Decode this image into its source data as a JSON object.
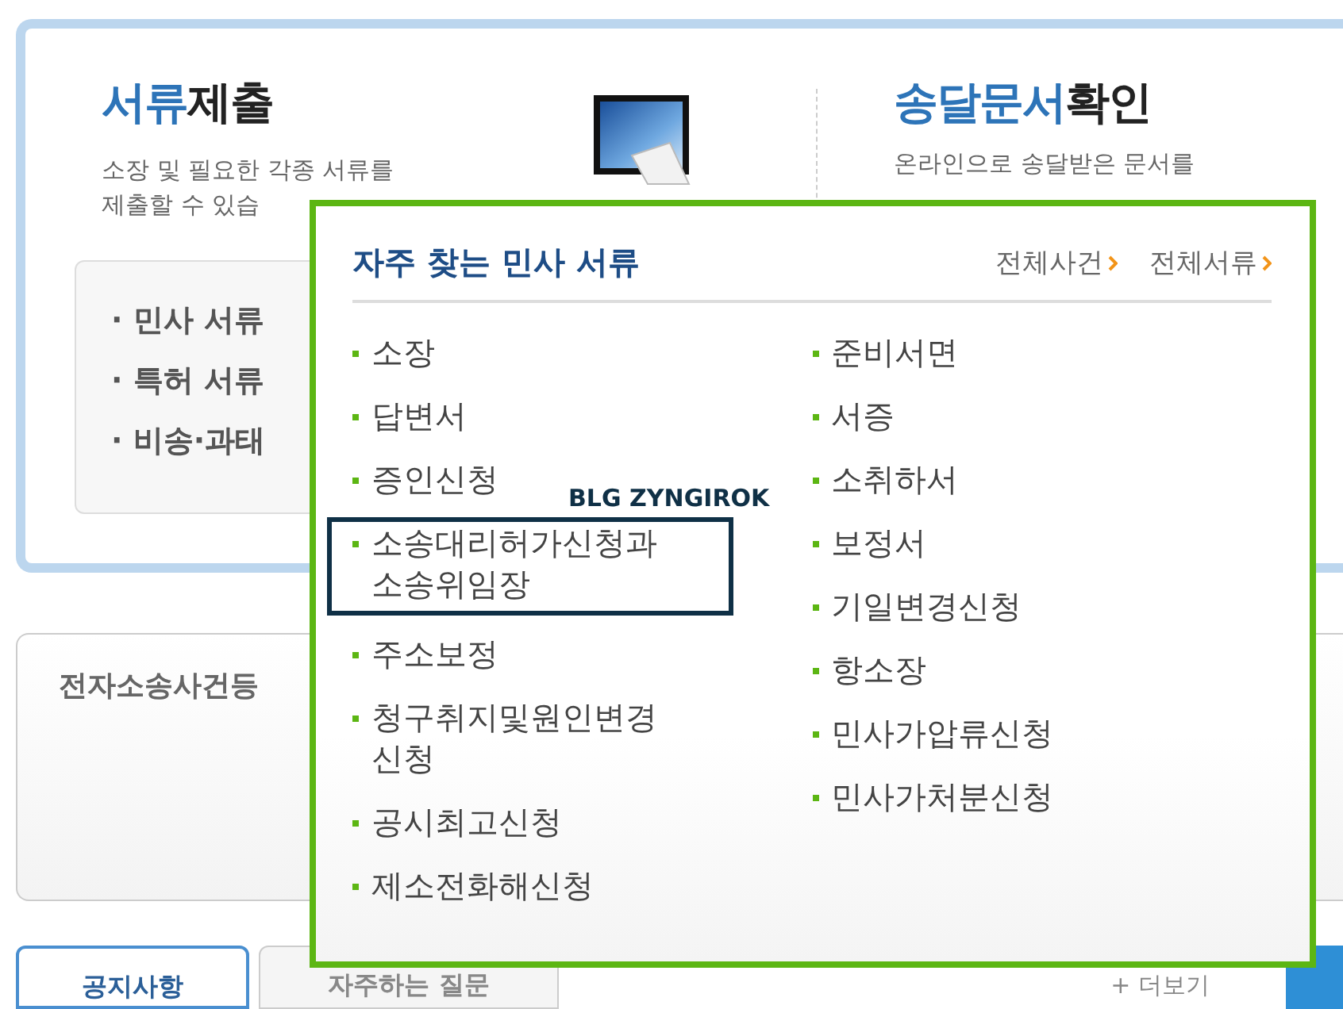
{
  "submit_card": {
    "title_accent": "서류",
    "title_rest": "제출",
    "description": [
      "소장 및 필요한 각종 서류를",
      "제출할 수 있습"
    ],
    "menu": [
      "· 민사 서류",
      "· 특허 서류",
      "· 비송·과태"
    ]
  },
  "delivery_card": {
    "title_accent": "송달문서",
    "title_rest": "확인",
    "description": "온라인으로 송달받은 문서를"
  },
  "register_card": {
    "title": "전자소송사건등"
  },
  "tabs": [
    {
      "label": "공지사항",
      "selected": true
    },
    {
      "label": "자주하는 질문",
      "selected": false
    }
  ],
  "more_link": "+ 더보기",
  "popup": {
    "title": "자주 찾는 민사 서류",
    "links": [
      "전체사건",
      "전체서류"
    ],
    "annotation_label": "BLG ZYNGIROK",
    "columns": [
      [
        {
          "label": "소장",
          "boxed": false
        },
        {
          "label": "답변서",
          "boxed": false
        },
        {
          "label": "증인신청",
          "boxed": false
        },
        {
          "label": "소송대리허가신청과 소송위임장",
          "boxed": true
        },
        {
          "label": "주소보정",
          "boxed": false
        },
        {
          "label": "청구취지및원인변경 신청",
          "boxed": false
        },
        {
          "label": "공시최고신청",
          "boxed": false
        },
        {
          "label": "제소전화해신청",
          "boxed": false
        }
      ],
      [
        {
          "label": "준비서면",
          "boxed": false
        },
        {
          "label": "서증",
          "boxed": false
        },
        {
          "label": "소취하서",
          "boxed": false
        },
        {
          "label": "보정서",
          "boxed": false
        },
        {
          "label": "기일변경신청",
          "boxed": false
        },
        {
          "label": "항소장",
          "boxed": false
        },
        {
          "label": "민사가압류신청",
          "boxed": false
        },
        {
          "label": "민사가처분신청",
          "boxed": false
        }
      ]
    ]
  }
}
